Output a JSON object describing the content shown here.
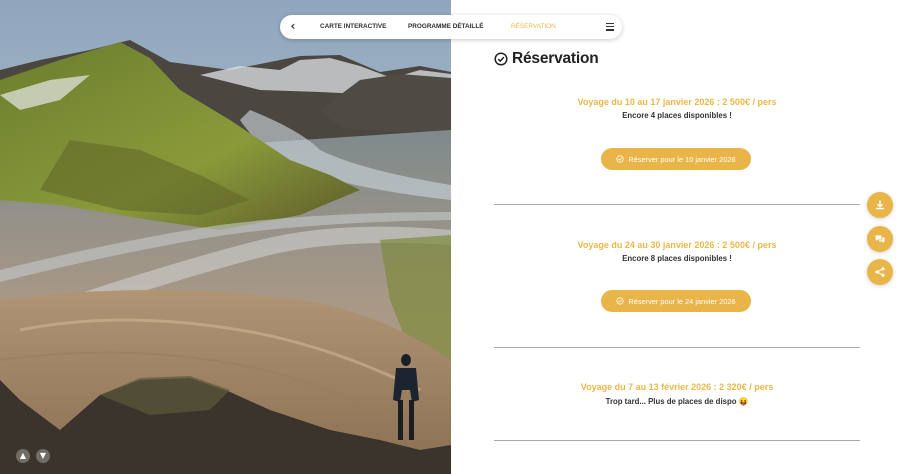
{
  "nav": {
    "back_icon": "chevron-left-icon",
    "tabs": [
      {
        "label": "CARTE INTERACTIVE",
        "active": false
      },
      {
        "label": "PROGRAMME DÉTAILLÉ",
        "active": false
      },
      {
        "label": "RÉSERVATION",
        "active": true
      }
    ],
    "menu_icon": "hamburger-menu-icon"
  },
  "section": {
    "title": "Réservation",
    "icon": "check-circle-icon"
  },
  "trips": [
    {
      "title": "Voyage du 10 au 17 janvier 2026 : 2 500€ / pers",
      "availability": "Encore 4 places disponibles !",
      "button_label": "Réserver pour le 10 janvier 2026"
    },
    {
      "title": "Voyage du 24 au 30 janvier 2026 : 2 500€ / pers",
      "availability": "Encore 8 places disponibles !",
      "button_label": "Réserver pour le 24 janvier 2026"
    },
    {
      "title": "Voyage du 7 au 13 février 2026 : 2 320€ / pers",
      "availability": "Trop tard... Plus de places de dispo 😝"
    }
  ],
  "floating_actions": [
    {
      "icon": "download-icon"
    },
    {
      "icon": "chat-icon"
    },
    {
      "icon": "share-icon"
    }
  ],
  "scroll_controls": [
    {
      "icon": "arrow-up-icon"
    },
    {
      "icon": "arrow-down-icon"
    }
  ],
  "colors": {
    "accent": "#EAB548",
    "accent_text": "#E8B84A",
    "text": "#222222",
    "divider": "#A9A9A9"
  }
}
